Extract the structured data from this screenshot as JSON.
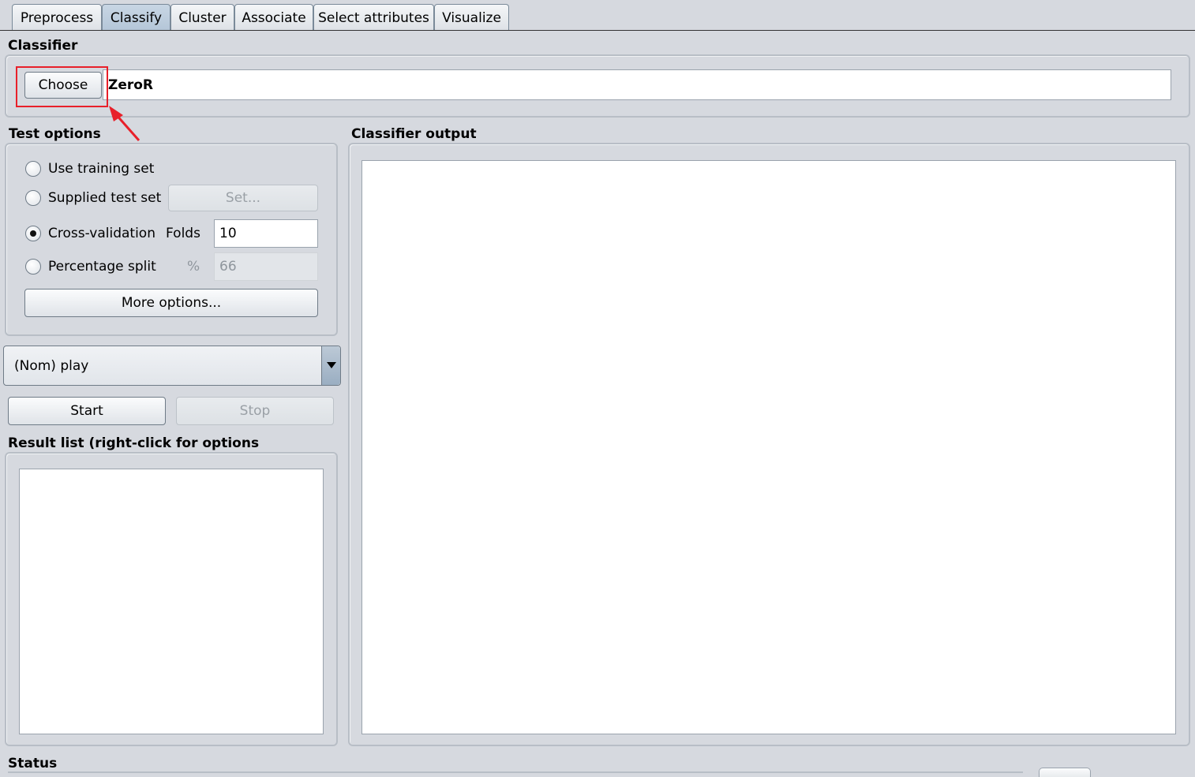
{
  "tabs": [
    {
      "label": "Preprocess",
      "active": false
    },
    {
      "label": "Classify",
      "active": true
    },
    {
      "label": "Cluster",
      "active": false
    },
    {
      "label": "Associate",
      "active": false
    },
    {
      "label": "Select attributes",
      "active": false
    },
    {
      "label": "Visualize",
      "active": false
    }
  ],
  "classifier": {
    "section_title": "Classifier",
    "choose_label": "Choose",
    "name": "ZeroR"
  },
  "test_options": {
    "section_title": "Test options",
    "use_training_set": "Use training set",
    "supplied_test_set": "Supplied test set",
    "set_button": "Set...",
    "cross_validation": "Cross-validation",
    "folds_label": "Folds",
    "folds_value": "10",
    "percentage_split": "Percentage split",
    "percent_label": "%",
    "percent_value": "66",
    "more_options": "More options...",
    "selected": "cross_validation"
  },
  "class_attribute": {
    "selected": "(Nom) play"
  },
  "run": {
    "start_label": "Start",
    "stop_label": "Stop"
  },
  "result_list": {
    "section_title": "Result list (right-click for options"
  },
  "output": {
    "section_title": "Classifier output"
  },
  "status": {
    "section_title": "Status"
  },
  "annotation": {
    "color": "#e8202a"
  }
}
